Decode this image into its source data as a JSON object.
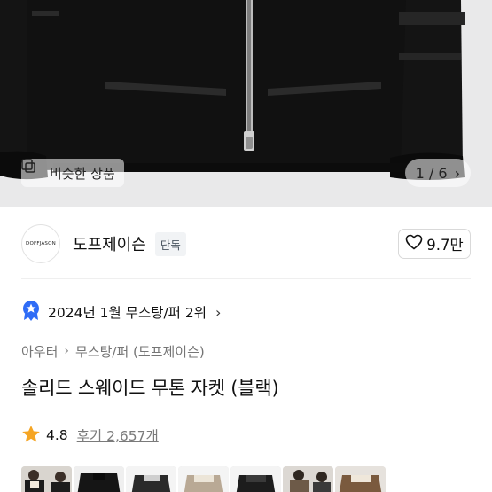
{
  "hero": {
    "similar_label": "비슷한 상품",
    "pager": "1 / 6",
    "pager_next": "›"
  },
  "brand": {
    "logo_text": "DOFFJASON",
    "name": "도프제이슨",
    "badge": "단독",
    "likes": "9.7만"
  },
  "ranking": {
    "text": "2024년 1월 무스탕/퍼 2위",
    "chevron": "›"
  },
  "breadcrumbs": [
    "아우터",
    "무스탕/퍼 (도프제이슨)"
  ],
  "breadcrumb_sep": "›",
  "product": {
    "title": "솔리드 스웨이드 무톤 자켓 (블랙)"
  },
  "rating": {
    "score": "4.8",
    "reviews": "후기 2,657개"
  },
  "colors": {
    "star": "#f5a524",
    "rank_badge": "#2f6cf6"
  },
  "thumbnails": [
    "thumb-1",
    "thumb-2",
    "thumb-3",
    "thumb-4",
    "thumb-5",
    "thumb-6",
    "thumb-7"
  ]
}
